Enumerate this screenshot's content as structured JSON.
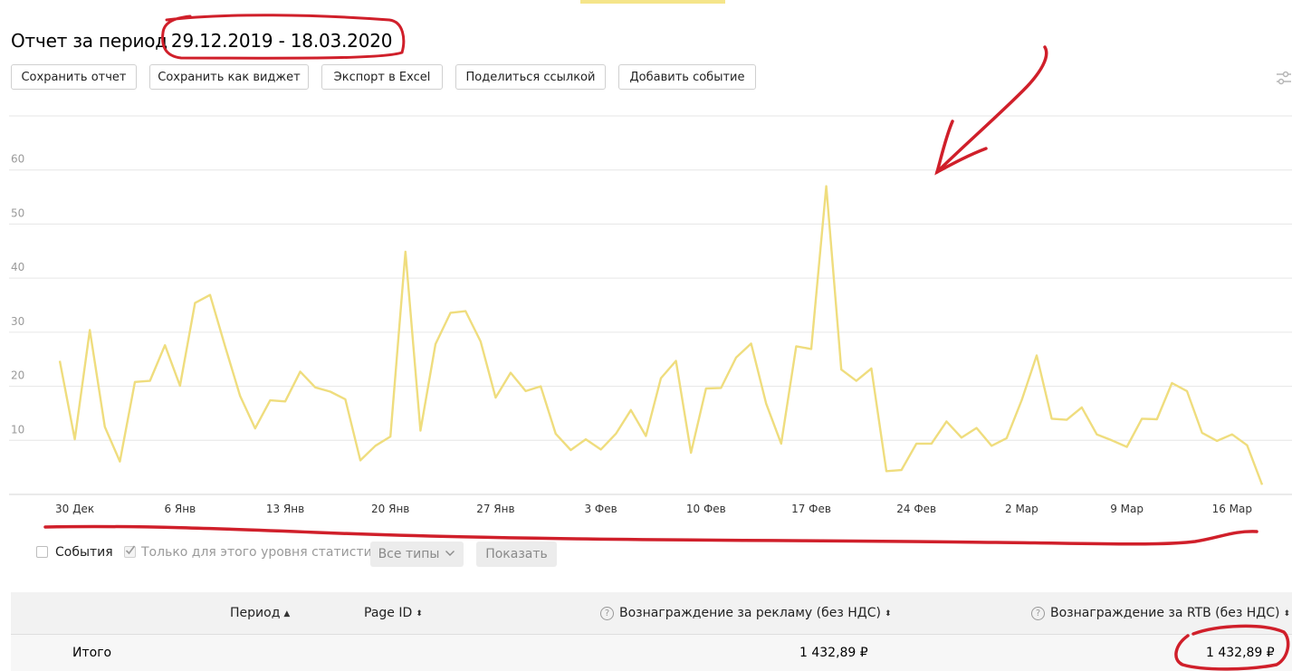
{
  "title": {
    "prefix": "Отчет за период",
    "range": "29.12.2019 - 18.03.2020"
  },
  "toolbar": {
    "save_report": "Сохранить отчет",
    "save_widget": "Сохранить как виджет",
    "export_excel": "Экспорт в Excel",
    "share_link": "Поделиться ссылкой",
    "add_event": "Добавить событие"
  },
  "events": {
    "events_label": "События",
    "only_level_label": "Только для этого уровня статистики",
    "all_types": "Все типы",
    "show": "Показать"
  },
  "table": {
    "headers": {
      "period": "Период",
      "page_id": "Page ID",
      "ad_reward": "Вознаграждение за рекламу (без НДС)",
      "rtb_reward": "Вознаграждение за RTB (без НДС)"
    },
    "total_row": {
      "label": "Итого",
      "ad_reward": "1 432,89 ₽",
      "rtb_reward": "1 432,89 ₽"
    }
  },
  "icons": {
    "settings": "sliders-icon",
    "sort_asc": "triangle-up-icon",
    "sort_both": "sort-arrows-icon",
    "help": "question-circle-icon"
  },
  "colors": {
    "line": "#efdd7e",
    "annotation": "#d01f2a",
    "grid": "#e6e6e6"
  },
  "chart_data": {
    "type": "line",
    "ylim": [
      0,
      70
    ],
    "yticks": [
      "10",
      "20",
      "30",
      "40",
      "50",
      "60",
      "70"
    ],
    "xtick_labels": [
      "30 Дек",
      "6 Янв",
      "13 Янв",
      "20 Янв",
      "27 Янв",
      "3 Фев",
      "10 Фев",
      "17 Фев",
      "24 Фев",
      "2 Мар",
      "9 Мар",
      "16 Мар"
    ],
    "x_start": "29.12.2019",
    "x_end": "18.03.2020",
    "grid": true,
    "series": [
      {
        "values": [
          24.7,
          10.2,
          30.4,
          12.5,
          6.1,
          20.8,
          21.0,
          27.6,
          20.1,
          35.4,
          36.9,
          27.4,
          18.2,
          12.2,
          17.4,
          17.2,
          22.7,
          19.8,
          19.0,
          17.6,
          6.3,
          9.0,
          10.7,
          44.9,
          11.8,
          27.8,
          33.6,
          33.9,
          28.3,
          17.9,
          22.5,
          19.1,
          20.0,
          11.2,
          8.2,
          10.2,
          8.3,
          11.2,
          15.6,
          10.8,
          21.5,
          24.7,
          7.7,
          19.6,
          19.7,
          25.3,
          27.9,
          16.8,
          9.4,
          27.4,
          26.9,
          57.0,
          23.1,
          21.0,
          23.3,
          4.3,
          4.5,
          9.4,
          9.4,
          13.5,
          10.5,
          12.3,
          9.0,
          10.4,
          17.4,
          25.7,
          14.0,
          13.8,
          16.1,
          11.1,
          10.0,
          8.8,
          14.0,
          13.9,
          20.6,
          19.1,
          11.4,
          9.9,
          11.1,
          9.1,
          1.8
        ]
      }
    ]
  }
}
